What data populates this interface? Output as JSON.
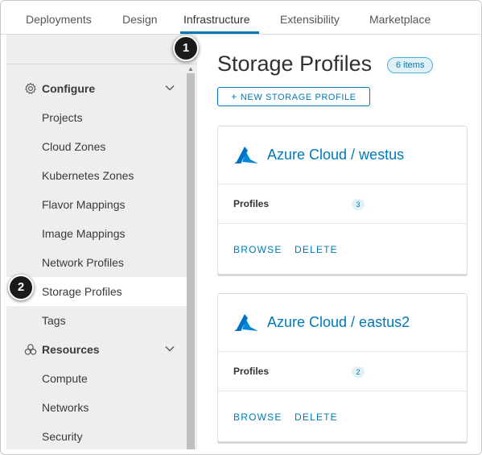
{
  "topnav": {
    "tabs": [
      {
        "label": "Deployments"
      },
      {
        "label": "Design"
      },
      {
        "label": "Infrastructure"
      },
      {
        "label": "Extensibility"
      },
      {
        "label": "Marketplace"
      }
    ],
    "active_tab": "Infrastructure"
  },
  "sidebar": {
    "sections": [
      {
        "label": "Configure",
        "icon": "gear-icon",
        "items": [
          {
            "label": "Projects"
          },
          {
            "label": "Cloud Zones"
          },
          {
            "label": "Kubernetes Zones"
          },
          {
            "label": "Flavor Mappings"
          },
          {
            "label": "Image Mappings"
          },
          {
            "label": "Network Profiles"
          },
          {
            "label": "Storage Profiles"
          },
          {
            "label": "Tags"
          }
        ]
      },
      {
        "label": "Resources",
        "icon": "resources-icon",
        "items": [
          {
            "label": "Compute"
          },
          {
            "label": "Networks"
          },
          {
            "label": "Security"
          }
        ]
      }
    ],
    "active_item": "Storage Profiles"
  },
  "main": {
    "title": "Storage Profiles",
    "count_badge": "6 items",
    "new_button": "NEW STORAGE PROFILE",
    "cards": [
      {
        "title": "Azure Cloud / westus",
        "profiles_label": "Profiles",
        "profiles_count": "3",
        "browse": "BROWSE",
        "delete": "DELETE"
      },
      {
        "title": "Azure Cloud / eastus2",
        "profiles_label": "Profiles",
        "profiles_count": "2",
        "browse": "BROWSE",
        "delete": "DELETE"
      }
    ]
  },
  "markers": [
    {
      "label": "1"
    },
    {
      "label": "2"
    }
  ],
  "colors": {
    "accent": "#0079b8",
    "sidebar_bg": "#eeeeee",
    "badge_bg": "#e1f1f6",
    "azure_blue": "#0072c6",
    "marker_bg": "#1a1a1a"
  }
}
